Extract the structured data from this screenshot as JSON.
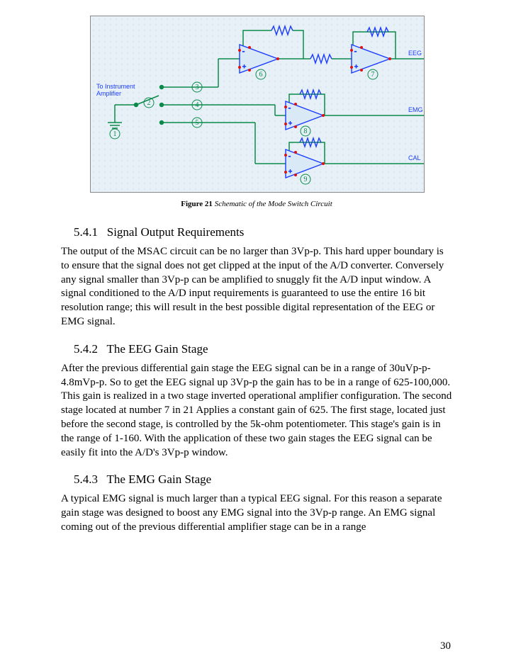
{
  "figure": {
    "label": "Figure 21",
    "caption_italic": "Schematic of the Mode Switch Circuit",
    "labels": {
      "instr_line1": "To Instrument",
      "instr_line2": "Amplifier",
      "eeg": "EEG",
      "emg": "EMG",
      "cal": "CAL",
      "n1": "1",
      "n2": "2",
      "n3": "3",
      "n4": "4",
      "n5": "5",
      "n6": "6",
      "n7": "7",
      "n8": "8",
      "n9": "9"
    }
  },
  "sections": {
    "s1": {
      "num": "5.4.1",
      "title": "Signal Output Requirements",
      "p": "The output of the MSAC circuit can be no larger than 3Vp‑p. This hard upper boundary is to ensure that the signal does not get clipped at the input of the A/D converter. Conversely any signal smaller than 3Vp‑p can be amplified to snuggly fit the A/D input window. A signal conditioned to the A/D input requirements is guaranteed to use the entire 16 bit resolution range; this will result in the best possible digital representation of the EEG or EMG signal."
    },
    "s2": {
      "num": "5.4.2",
      "title": "The EEG Gain Stage",
      "p": "After the previous differential gain stage the EEG signal can be in a range of 30uVp‑p- 4.8mVp‑p. So to get the EEG signal up 3Vp‑p the gain has to be in a range of 625-100,000. This gain is realized in a two stage inverted operational amplifier configuration. The second stage located at number 7 in 21 Applies a constant gain of 625. The first stage, located just before the second stage, is controlled by the 5k-ohm potentiometer. This stage's gain is in the range of 1-160. With the application of these two gain stages the EEG signal can be easily fit into the A/D's 3Vp‑p window."
    },
    "s3": {
      "num": "5.4.3",
      "title": "The EMG Gain Stage",
      "p": "A typical EMG signal is much larger than a typical EEG signal. For this reason a separate gain stage was designed to boost any EMG signal into the 3Vp‑p range. An EMG signal coming out of the previous differential amplifier stage can be in a range"
    }
  },
  "page_number": "30"
}
